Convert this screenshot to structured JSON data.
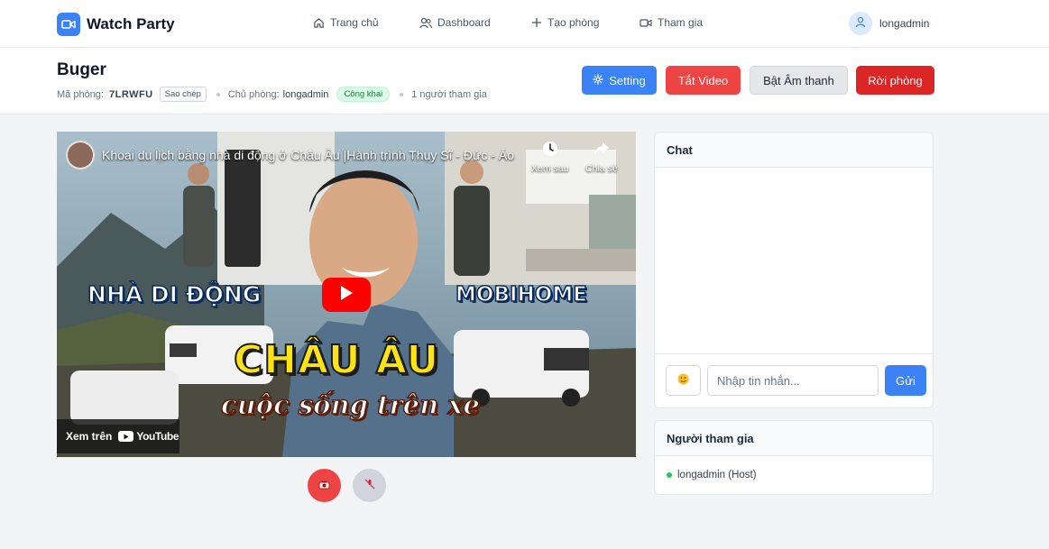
{
  "navbar": {
    "brand": "Watch Party",
    "items": [
      {
        "label": "Trang chủ",
        "icon": "home-icon"
      },
      {
        "label": "Dashboard",
        "icon": "users-icon"
      },
      {
        "label": "Tạo phòng",
        "icon": "plus-icon"
      },
      {
        "label": "Tham gia",
        "icon": "video-icon"
      }
    ],
    "user": "longadmin"
  },
  "room": {
    "name": "Buger",
    "code_label": "Mã phòng:",
    "code": "7LRWFU",
    "copy_label": "Sao chép",
    "owner_label": "Chủ phòng:",
    "owner": "longadmin",
    "visibility": "Công khai",
    "participant_count": "1 người tham gia"
  },
  "actions": {
    "setting": "Setting",
    "video": "Tắt Video",
    "audio": "Bật Âm thanh",
    "leave": "Rời phòng"
  },
  "player": {
    "title": "Khoai du lịch bằng nhà di động ở Châu Âu |Hành trình Thụy Sĩ - Đức - Áo",
    "watch_later": "Xem sau",
    "share": "Chia sẻ",
    "watch_on": "Xem trên",
    "youtube": "YouTube",
    "thumb_left": "NHÀ DI ĐỘNG",
    "thumb_right": "MOBIHOME",
    "thumb_big": "CHÂU ÂU",
    "thumb_script": "cuộc sống trên xe"
  },
  "chat": {
    "title": "Chat",
    "placeholder": "Nhập tin nhắn...",
    "send": "Gửi"
  },
  "participants": {
    "title": "Người tham gia",
    "list": [
      {
        "name": "longadmin (Host)",
        "status_color": "#22c55e"
      }
    ]
  },
  "colors": {
    "primary": "#3b82f6",
    "danger": "#ef4444",
    "leave": "#dc2626",
    "online": "#22c55e"
  }
}
